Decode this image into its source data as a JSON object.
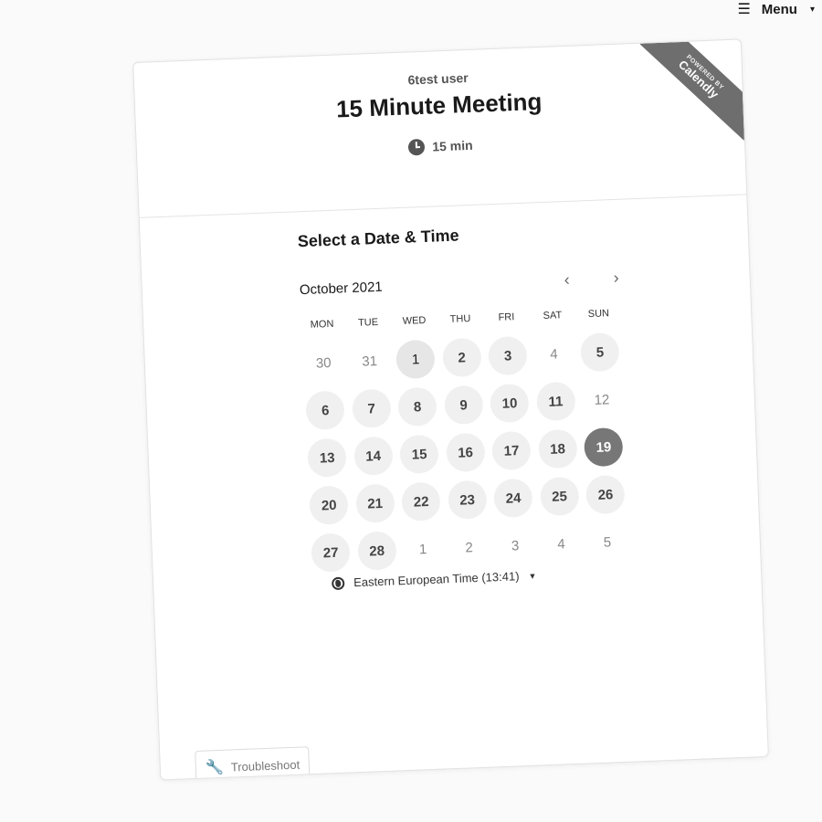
{
  "menu": {
    "label": "Menu"
  },
  "ribbon": {
    "powered": "POWERED BY",
    "brand": "Calendly"
  },
  "event": {
    "host": "6test user",
    "title": "15 Minute Meeting",
    "duration": "15 min"
  },
  "picker": {
    "section_title": "Select a Date & Time",
    "month": "October 2021",
    "weekdays": [
      "MON",
      "TUE",
      "WED",
      "THU",
      "FRI",
      "SAT",
      "SUN"
    ],
    "weeks": [
      [
        {
          "d": "30",
          "s": "off"
        },
        {
          "d": "31",
          "s": "off"
        },
        {
          "d": "1",
          "s": "today"
        },
        {
          "d": "2",
          "s": "avail"
        },
        {
          "d": "3",
          "s": "avail"
        },
        {
          "d": "4",
          "s": "off"
        },
        {
          "d": "5",
          "s": "avail"
        }
      ],
      [
        {
          "d": "6",
          "s": "avail"
        },
        {
          "d": "7",
          "s": "avail"
        },
        {
          "d": "8",
          "s": "avail"
        },
        {
          "d": "9",
          "s": "avail"
        },
        {
          "d": "10",
          "s": "avail"
        },
        {
          "d": "11",
          "s": "avail"
        },
        {
          "d": "12",
          "s": "off"
        }
      ],
      [
        {
          "d": "13",
          "s": "avail"
        },
        {
          "d": "14",
          "s": "avail"
        },
        {
          "d": "15",
          "s": "avail"
        },
        {
          "d": "16",
          "s": "avail"
        },
        {
          "d": "17",
          "s": "avail"
        },
        {
          "d": "18",
          "s": "avail"
        },
        {
          "d": "19",
          "s": "selected"
        }
      ],
      [
        {
          "d": "20",
          "s": "avail"
        },
        {
          "d": "21",
          "s": "avail"
        },
        {
          "d": "22",
          "s": "avail"
        },
        {
          "d": "23",
          "s": "avail"
        },
        {
          "d": "24",
          "s": "avail"
        },
        {
          "d": "25",
          "s": "avail"
        },
        {
          "d": "26",
          "s": "avail"
        }
      ],
      [
        {
          "d": "27",
          "s": "avail"
        },
        {
          "d": "28",
          "s": "avail"
        },
        {
          "d": "1",
          "s": "off"
        },
        {
          "d": "2",
          "s": "off"
        },
        {
          "d": "3",
          "s": "off"
        },
        {
          "d": "4",
          "s": "off"
        },
        {
          "d": "5",
          "s": "off"
        }
      ]
    ],
    "timezone": "Eastern European Time (13:41)"
  },
  "troubleshoot": {
    "label": "Troubleshoot"
  }
}
